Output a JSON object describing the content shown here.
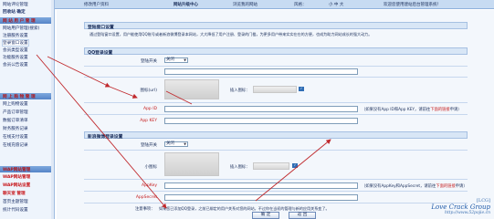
{
  "topbar": {
    "items": [
      "修改用户资料",
      "网站升级中心",
      "浏览我的网站",
      "风格：",
      "小  中  大",
      "欢迎您使用建站后台管理系统！"
    ]
  },
  "sidebar": {
    "top_items": [
      "网站评论管理",
      "回收站  确定"
    ],
    "group1": {
      "title": "网 站 用 户 管 理",
      "items": [
        "网站用户管理(搜索)",
        "注册服务设置",
        "登录窗口设置",
        "会员类型设置",
        "功能服务设置",
        "会员公告设置"
      ]
    },
    "group2": {
      "title": "网 上 购 物 管 理",
      "items": [
        "网上购物设置",
        "产品订单管理",
        "数据订单清单",
        "财务服务记录",
        "在线支付设置",
        "在线充值记录"
      ]
    },
    "group3": {
      "title": "WAP网站管理",
      "items": [
        "WAP网站管理",
        "WAP网站设置",
        "聊天室  管理",
        "首页主题管理",
        "统计代码设置"
      ]
    }
  },
  "main": {
    "section1": {
      "title": "登陆窗口设置",
      "desc": "通过登陆窗口设置，用户能使用QQ账号或者新浪微博登录本网站，大大降低了用户注册、登录的门槛，为更多用户带来实实在在的方便，也成为助力网站成长的强大动力。"
    },
    "section2": {
      "title": "QQ登录设置",
      "rows": [
        {
          "label": "登陆开关",
          "select": "关闭"
        },
        {
          "label": "",
          "field": ""
        },
        {
          "label": "图标(url)",
          "insert_label": "插入图标：",
          "badge": "✓"
        },
        {
          "label": "App ID",
          "field": "",
          "hint": "（如果没有App ID和App KEY，请前往",
          "link": "下面的链接",
          "hint2": "申请）"
        },
        {
          "label": "App KEY",
          "field": ""
        }
      ]
    },
    "section3": {
      "title": "新浪微博登录设置",
      "rows": [
        {
          "label": "登陆开关",
          "select": "关闭"
        },
        {
          "label": "小图标",
          "insert_label": "插入图标：",
          "badge": "✓"
        },
        {
          "label": "AppKey",
          "field": "",
          "hint": "（如果没有AppKey和AppSecret，请前往",
          "link": "下面的链接",
          "hint2": "申请）"
        },
        {
          "label": "AppSecret",
          "field": ""
        }
      ]
    },
    "notice": {
      "label": "注意事项：",
      "text": "如果您已添加QQ登录，之前已绑定的用户关系对您的网站，不过你在当初的管理与新的应用关系变了。"
    },
    "buttons": {
      "ok": "确  定",
      "back": "返  回"
    }
  },
  "watermark": {
    "tag": "[LCG]",
    "name": "Love Crack Group",
    "url": "http://www.52pojie.cn"
  },
  "colors": {
    "sidebar_bg": "#eef4fc",
    "header_blue": "#5584c7",
    "accent_red": "#c8181c",
    "arrow_red": "#c0282c"
  }
}
